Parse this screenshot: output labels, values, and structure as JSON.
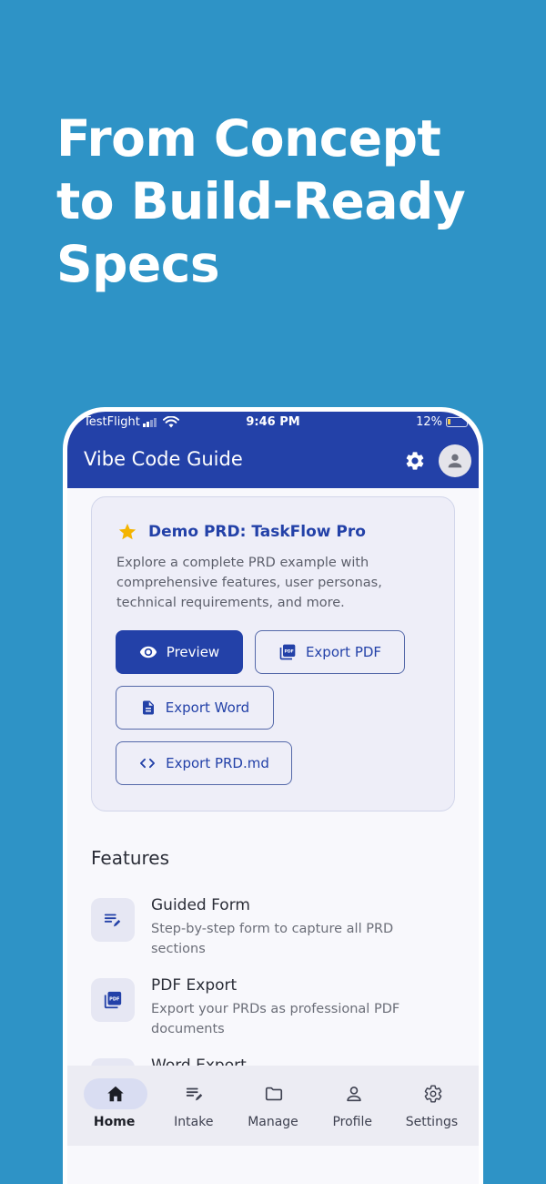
{
  "marketing": {
    "headline_line1": "From Concept",
    "headline_line2": "to Build-Ready",
    "headline_line3": "Specs"
  },
  "status_bar": {
    "carrier": "TestFlight",
    "time": "9:46 PM",
    "battery": "12%"
  },
  "app_bar": {
    "title": "Vibe Code Guide",
    "icons": [
      "gear-icon",
      "account-icon"
    ]
  },
  "demo_card": {
    "star_icon": "star-icon",
    "title": "Demo PRD: TaskFlow Pro",
    "description": "Explore a complete PRD example with comprehensive features, user personas, technical requirements, and more.",
    "buttons": [
      {
        "label": "Preview",
        "icon": "eye-icon"
      },
      {
        "label": "Export PDF",
        "icon": "pdf-icon"
      },
      {
        "label": "Export Word",
        "icon": "document-icon"
      },
      {
        "label": "Export PRD.md",
        "icon": "code-icon"
      }
    ]
  },
  "features": {
    "title": "Features",
    "items": [
      {
        "title": "Guided Form",
        "description": "Step-by-step form to capture all PRD sections",
        "icon": "edit-note-icon"
      },
      {
        "title": "PDF Export",
        "description": "Export your PRDs as professional PDF documents",
        "icon": "pdf-icon"
      },
      {
        "title": "Word Export",
        "description": "",
        "icon": "word-icon"
      }
    ]
  },
  "bottom_nav": {
    "items": [
      {
        "label": "Home",
        "icon": "home-icon",
        "active": true
      },
      {
        "label": "Intake",
        "icon": "edit-note-icon",
        "active": false
      },
      {
        "label": "Manage",
        "icon": "folder-icon",
        "active": false
      },
      {
        "label": "Profile",
        "icon": "person-icon",
        "active": false
      },
      {
        "label": "Settings",
        "icon": "gear-icon",
        "active": false
      }
    ]
  },
  "colors": {
    "background": "#2E93C6",
    "app_bar": "#2341A8",
    "primary": "#2341A8",
    "star": "#F4B400",
    "card_bg": "#EEEEF8"
  }
}
